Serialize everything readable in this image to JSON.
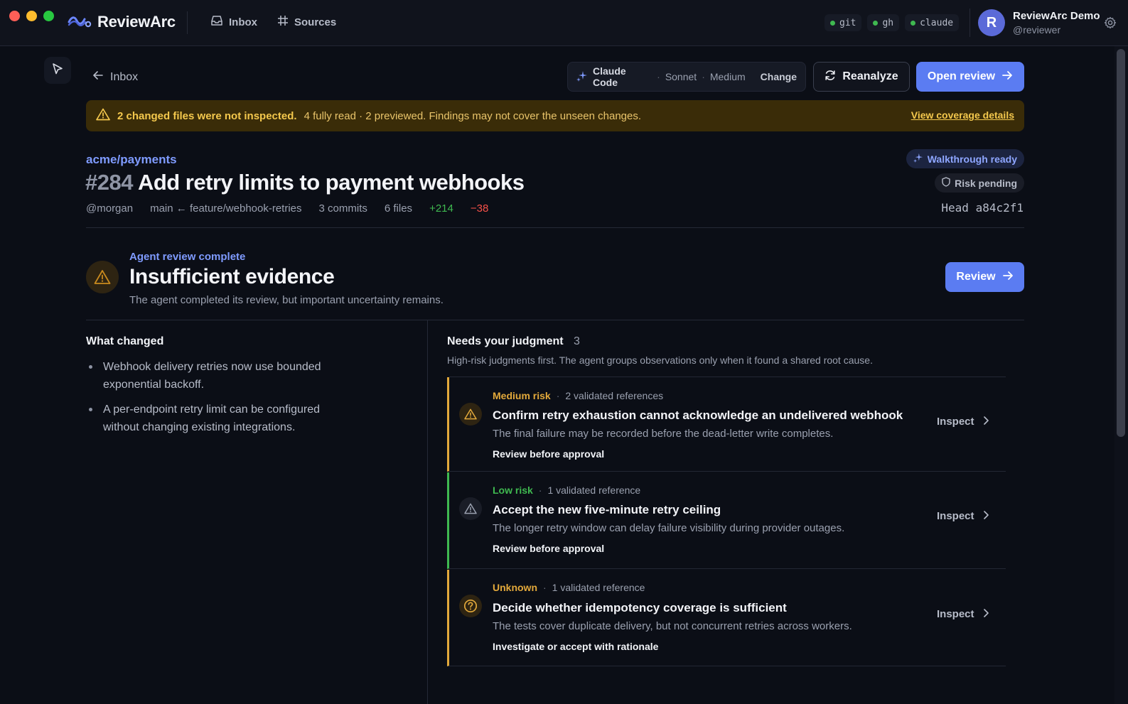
{
  "topbar": {
    "brand": "ReviewArc",
    "nav": [
      {
        "label": "Inbox",
        "icon": "inbox-icon"
      },
      {
        "label": "Sources",
        "icon": "grid-icon"
      }
    ],
    "status_pills": [
      "git",
      "gh",
      "claude"
    ],
    "status_color": "#3fb950",
    "user": {
      "initial": "R",
      "name": "ReviewArc Demo",
      "handle": "@reviewer"
    }
  },
  "header": {
    "back_label": "Inbox",
    "model": {
      "agent": "Claude Code",
      "model": "Sonnet",
      "effort": "Medium",
      "change_label": "Change"
    },
    "reanalyze_label": "Reanalyze",
    "open_review_label": "Open review"
  },
  "banner": {
    "bold": "2 changed files were not inspected.",
    "text": "4 fully read · 2 previewed. Findings may not cover the unseen changes.",
    "link": "View coverage details"
  },
  "pr": {
    "repo": "acme/payments",
    "number": "#284",
    "title": "Add retry limits to payment webhooks",
    "author": "@morgan",
    "branch": "main ← feature/webhook-retries",
    "commits": "3 commits",
    "files": "6 files",
    "additions": "+214",
    "deletions": "−38",
    "walkthrough_badge": "Walkthrough ready",
    "risk_badge": "Risk pending",
    "head": "Head a84c2f1"
  },
  "verdict": {
    "kicker": "Agent review complete",
    "title": "Insufficient evidence",
    "subtitle": "The agent completed its review, but important uncertainty remains.",
    "review_label": "Review"
  },
  "what_changed": {
    "title": "What changed",
    "items": [
      "Webhook delivery retries now use bounded exponential backoff.",
      "A per-endpoint retry limit can be configured without changing existing integrations."
    ]
  },
  "judgment": {
    "title": "Needs your judgment",
    "count": "3",
    "subtitle": "High-risk judgments first. The agent groups observations only when it found a shared root cause.",
    "inspect_label": "Inspect",
    "items": [
      {
        "level": "Medium risk",
        "refs": "2 validated references",
        "title": "Confirm retry exhaustion cannot acknowledge an undelivered webhook",
        "desc": "The final failure may be recorded before the dead-letter write completes.",
        "action": "Review before approval",
        "icon": "warning-icon",
        "color": "#e3a93b"
      },
      {
        "level": "Low risk",
        "refs": "1 validated reference",
        "title": "Accept the new five-minute retry ceiling",
        "desc": "The longer retry window can delay failure visibility during provider outages.",
        "action": "Review before approval",
        "icon": "warning-icon",
        "color": "#3fb950"
      },
      {
        "level": "Unknown",
        "refs": "1 validated reference",
        "title": "Decide whether idempotency coverage is sufficient",
        "desc": "The tests cover duplicate delivery, but not concurrent retries across workers.",
        "action": "Investigate or accept with rationale",
        "icon": "question-icon",
        "color": "#e3a93b"
      }
    ]
  }
}
